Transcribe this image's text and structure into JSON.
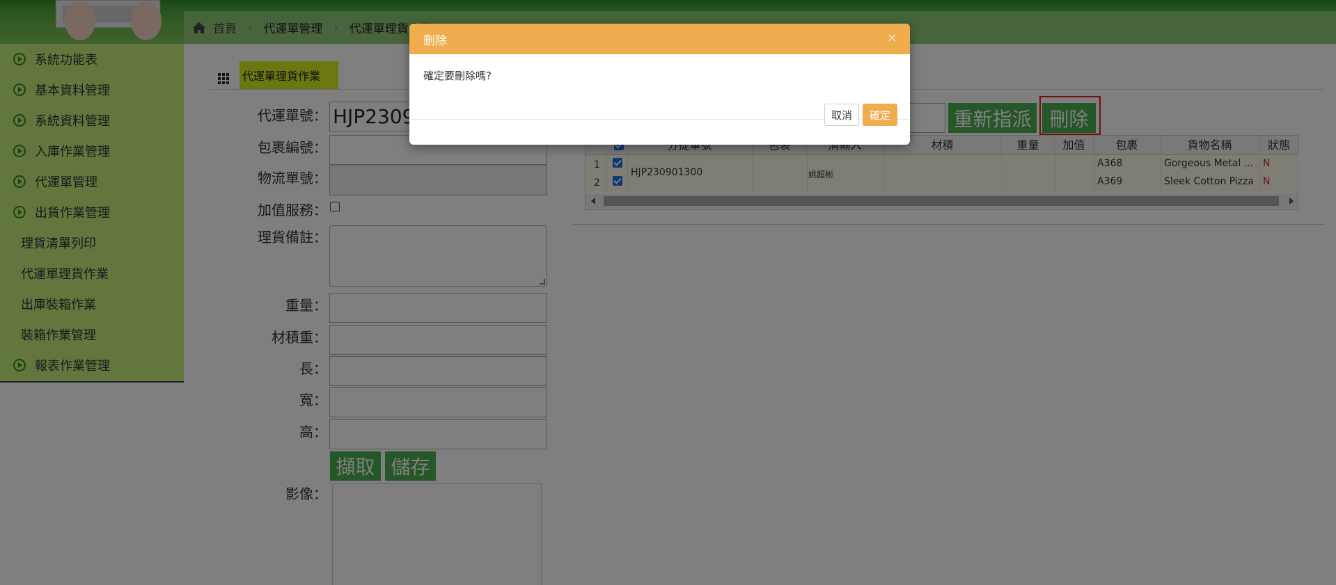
{
  "breadcrumb": {
    "home": "首頁",
    "level1": "代運單管理",
    "level2": "代運單理貨作業"
  },
  "sidebar": {
    "items": [
      {
        "label": "系統功能表"
      },
      {
        "label": "基本資料管理"
      },
      {
        "label": "系統資料管理"
      },
      {
        "label": "入庫作業管理"
      },
      {
        "label": "代運單管理"
      },
      {
        "label": "出貨作業管理"
      }
    ],
    "subitems": [
      {
        "label": "理貨清單列印"
      },
      {
        "label": "代運單理貨作業"
      },
      {
        "label": "出庫裝箱作業"
      },
      {
        "label": "裝箱作業管理"
      }
    ],
    "last_item": {
      "label": "報表作業管理"
    }
  },
  "page": {
    "title": "代運單理貨作業"
  },
  "form": {
    "waybill_no_label": "代運單號：",
    "waybill_no_value": "HJP2309",
    "parcel_no_label": "包裹編號：",
    "logistics_no_label": "物流單號：",
    "value_added_label": "加值服務：",
    "remark_label": "理貨備註：",
    "weight_label": "重量：",
    "volume_weight_label": "材積重：",
    "length_label": "長：",
    "width_label": "寬：",
    "height_label": "高：",
    "capture_button": "擷取",
    "save_button": "儲存",
    "image_label": "影像："
  },
  "toolbar": {
    "reassign_button": "重新指派",
    "delete_button": "刪除"
  },
  "table": {
    "headers": [
      "分提單號",
      "包裝",
      "清輸入",
      "材積",
      "重量",
      "加值",
      "包裹",
      "貨物名稱",
      "狀態"
    ],
    "rows": [
      {
        "num": "1",
        "parcel": "A368",
        "goods": "Gorgeous Metal ...",
        "status": "N"
      },
      {
        "num": "2",
        "parcel": "A369",
        "goods": "Sleek Cotton Pizza",
        "status": "N"
      }
    ],
    "merged_waybill": "HJP230901300",
    "merged_importer": "姚超彬"
  },
  "modal": {
    "title": "刪除",
    "close": "×",
    "message": "確定要刪除嗎?",
    "cancel": "取消",
    "ok": "確定"
  },
  "colors": {
    "modal_header": "#f0ad4e",
    "sidebar_bg": "#c6ec7c",
    "button_green": "#4caf50",
    "title_highlight": "#d6f020",
    "status_red": "#e02020"
  }
}
